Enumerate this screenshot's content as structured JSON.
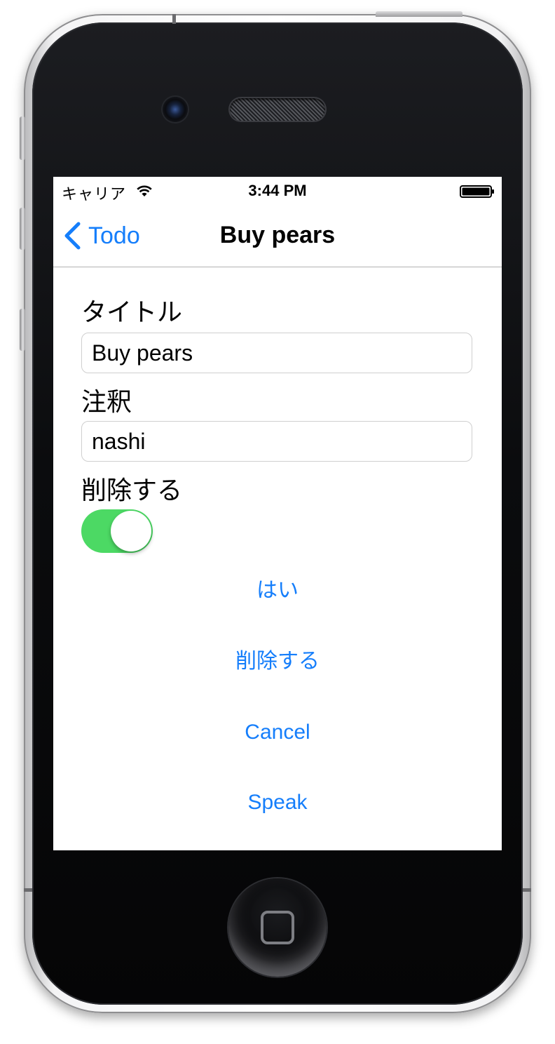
{
  "status_bar": {
    "carrier": "キャリア",
    "time": "3:44 PM"
  },
  "nav": {
    "back_label": "Todo",
    "title": "Buy pears"
  },
  "form": {
    "title_label": "タイトル",
    "title_value": "Buy pears",
    "notes_label": "注釈",
    "notes_value": "nashi",
    "done_label": "削除する",
    "done_toggle_on": true
  },
  "actions": {
    "yes": "はい",
    "delete": "削除する",
    "cancel": "Cancel",
    "speak": "Speak"
  },
  "colors": {
    "accent": "#157efb",
    "toggle_on": "#4cd964"
  },
  "icons": {
    "back": "chevron-left-icon",
    "wifi": "wifi-icon",
    "battery": "battery-icon"
  }
}
